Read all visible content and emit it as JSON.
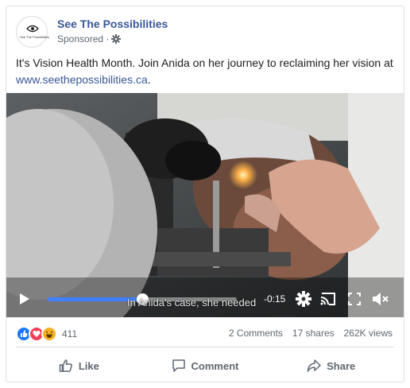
{
  "post": {
    "page_name": "See The Possibilities",
    "avatar_text": "See The Possibilities",
    "sponsored": "Sponsored ·",
    "caption_text": "It's Vision Health Month. Join Anida on her journey to reclaiming her vision at",
    "caption_link": "www.seethepossibilities.ca",
    "caption_end": "."
  },
  "video": {
    "subtitle": "In Anida's case, she needed",
    "time_remaining": "-0:15",
    "progress_fraction": 0.5
  },
  "engagement": {
    "reaction_count": "411",
    "comments": "2 Comments",
    "shares": "17 shares",
    "views": "262K views",
    "reactions": [
      "like-reaction-icon",
      "love-reaction-icon",
      "haha-reaction-icon"
    ]
  },
  "actions": {
    "like": "Like",
    "comment": "Comment",
    "share": "Share"
  },
  "colors": {
    "link": "#385898",
    "progress": "#4080ff",
    "text": "#1c1e21",
    "muted": "#606770"
  }
}
